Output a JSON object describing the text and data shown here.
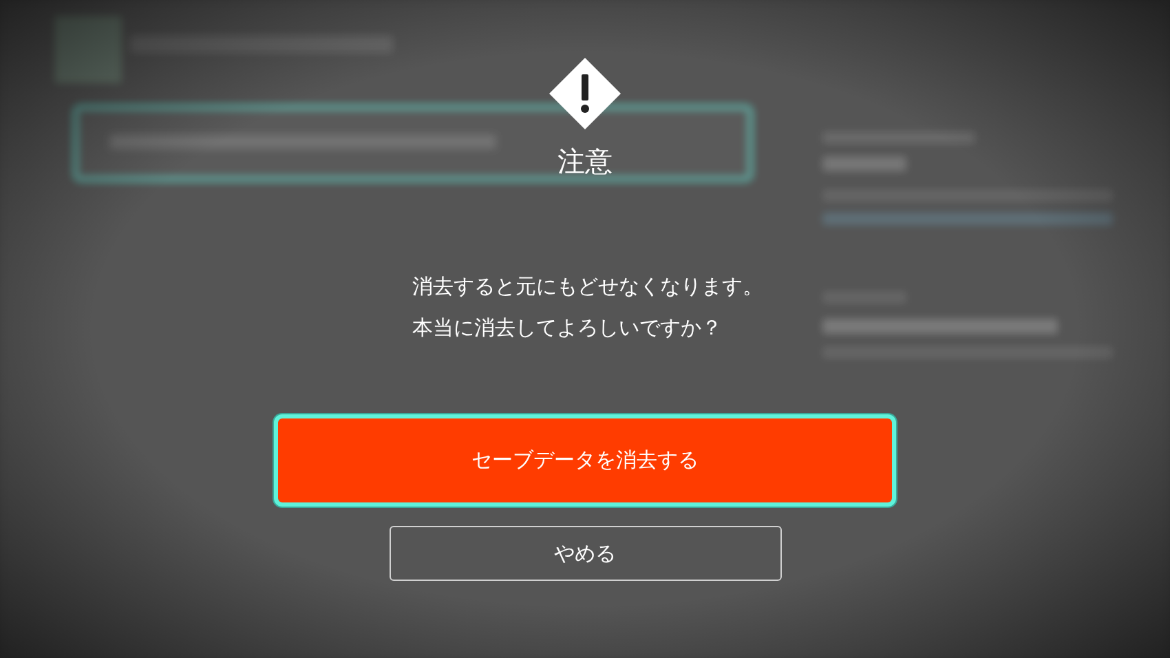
{
  "dialog": {
    "title": "注意",
    "message": [
      "消去すると元にもどせなくなります。",
      "本当に消去してよろしいですか？"
    ],
    "buttons": [
      {
        "label": "セーブデータを消去する",
        "kind": "primary",
        "selected": true
      },
      {
        "label": "やめる",
        "kind": "secondary",
        "selected": false
      }
    ]
  }
}
